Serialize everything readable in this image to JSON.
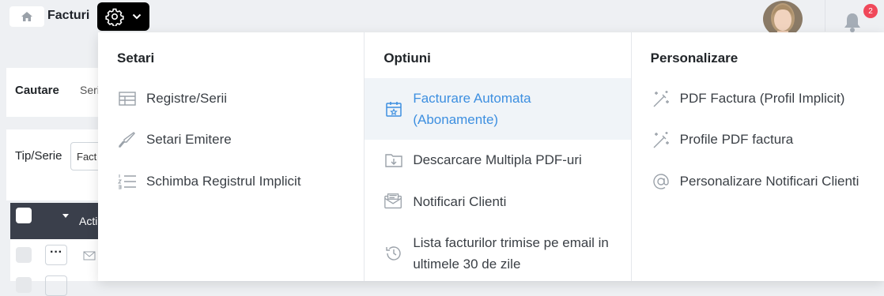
{
  "header": {
    "breadcrumb": "Facturi",
    "notification_count": "2"
  },
  "background": {
    "search_title": "Cautare",
    "search_tab": "Seri",
    "tip_serie_label": "Tip/Serie",
    "tip_serie_value": "Fact",
    "actions_header": "Acti"
  },
  "menu": {
    "setari": {
      "title": "Setari",
      "items": [
        {
          "label": "Registre/Serii",
          "icon": "table-icon"
        },
        {
          "label": "Setari Emitere",
          "icon": "brush-icon"
        },
        {
          "label": "Schimba Registrul Implicit",
          "icon": "list-ordered-icon"
        }
      ]
    },
    "optiuni": {
      "title": "Optiuni",
      "items": [
        {
          "label": "Facturare Automata (Abonamente)",
          "icon": "calendar-star-icon",
          "active": true
        },
        {
          "label": "Descarcare Multipla PDF-uri",
          "icon": "folder-download-icon"
        },
        {
          "label": "Notificari Clienti",
          "icon": "mail-open-icon"
        },
        {
          "label": "Lista facturilor trimise pe email in ultimele 30 de zile",
          "icon": "history-icon"
        }
      ]
    },
    "personalizare": {
      "title": "Personalizare",
      "items": [
        {
          "label": "PDF Factura (Profil Implicit)",
          "icon": "magic-wand-icon"
        },
        {
          "label": "Profile PDF factura",
          "icon": "magic-wand-icon"
        },
        {
          "label": "Personalizare Notificari Clienti",
          "icon": "at-icon"
        }
      ]
    }
  },
  "colors": {
    "accent": "#3d8fe0",
    "active_bg": "#f0f4f8",
    "badge": "#f0485a",
    "table_header": "#3a3f4b"
  }
}
